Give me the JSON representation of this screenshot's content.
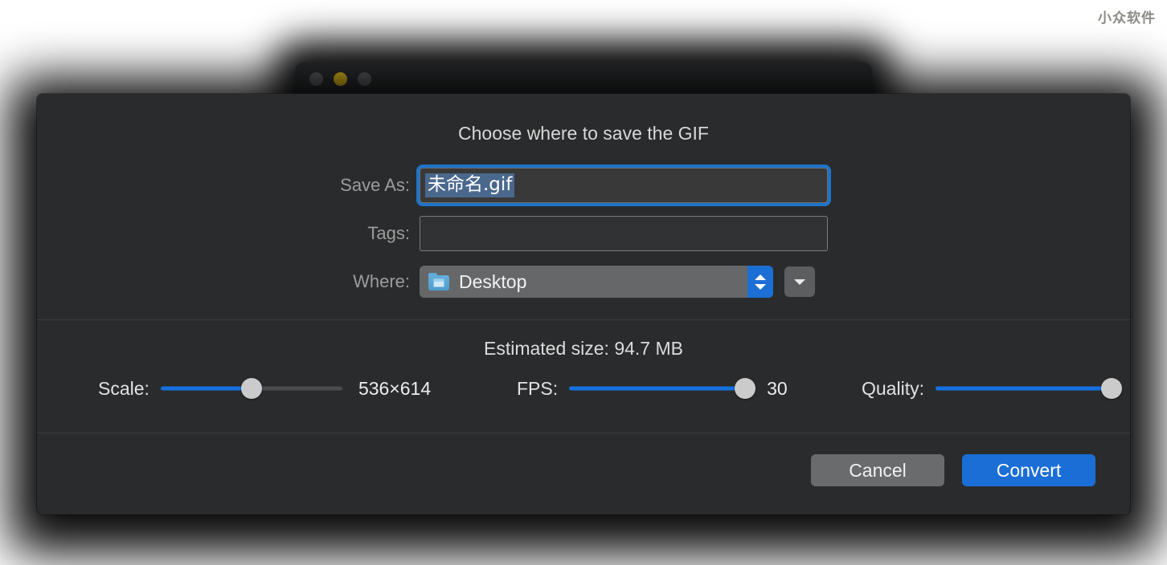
{
  "watermark": {
    "text": "小众软件"
  },
  "background_window": {
    "traffic_lights": [
      {
        "name": "close",
        "color": "#5b5e60"
      },
      {
        "name": "minimize",
        "color": "#e8c01f"
      },
      {
        "name": "zoom",
        "color": "#5b5e60"
      }
    ]
  },
  "dialog": {
    "title": "Choose where to save the GIF",
    "fields": {
      "save_as": {
        "label": "Save As:",
        "value": "未命名.gif",
        "selected": true,
        "focused": true
      },
      "tags": {
        "label": "Tags:",
        "value": "",
        "placeholder": ""
      },
      "where": {
        "label": "Where:",
        "value": "Desktop",
        "icon": "desktop-folder-icon",
        "stepper_icon": "up-down-chevron-icon",
        "expand_icon": "chevron-down-icon"
      }
    },
    "options": {
      "estimated_size_text": "Estimated size: 94.7 MB",
      "sliders": [
        {
          "label": "Scale:",
          "value_text": "536×614",
          "fill_percent": 50
        },
        {
          "label": "FPS:",
          "value_text": "30",
          "fill_percent": 97
        },
        {
          "label": "Quality:",
          "value_text": "",
          "fill_percent": 97
        }
      ]
    },
    "buttons": {
      "cancel": "Cancel",
      "convert": "Convert"
    }
  },
  "colors": {
    "accent_blue": "#1571e0",
    "primary_button": "#1a6ed6",
    "sheet_background": "#2a2b2c",
    "selection_blue": "#4a688c"
  }
}
